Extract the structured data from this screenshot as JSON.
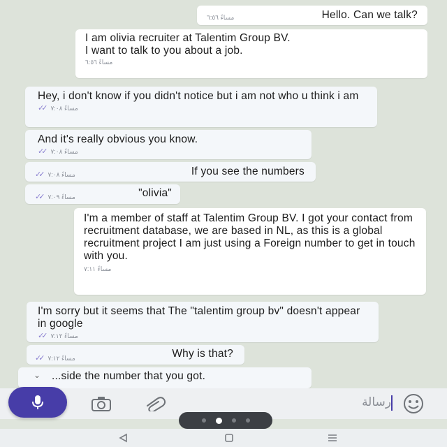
{
  "conversation": {
    "messages": [
      {
        "direction": "out",
        "text": "Hello. Can we talk?",
        "time": "مساءً ٦:٥٦"
      },
      {
        "direction": "out",
        "text": "I am olivia recruiter at Talentim Group BV.\nI want to talk to you about a job.",
        "time": "مساءً ٦:٥٦"
      },
      {
        "direction": "in",
        "text": "Hey, i don't know if you didn't notice but i am not who u think i am",
        "time": "مساءً ٧:٠٨"
      },
      {
        "direction": "in",
        "text": "And it's really obvious you know.",
        "time": "مساءً ٧:٠٨"
      },
      {
        "direction": "in",
        "text": "If you see the numbers",
        "time": "مساءً ٧:٠٨"
      },
      {
        "direction": "in",
        "text": "\"olivia\"",
        "time": "مساءً ٧:٠٩"
      },
      {
        "direction": "out",
        "text": "I'm a member of staff at Talentim Group BV. I got your contact from recruitment database, we are based in NL, as this is a global recruitment project I am just using a Foreign number to get in touch with you.",
        "time": "مساءً ٧:١١"
      },
      {
        "direction": "in",
        "text": "I'm sorry but it seems that The \"talentim group bv\" doesn't appear in google",
        "time": "مساءً ٧:١٢"
      },
      {
        "direction": "in",
        "text": "Why is that?",
        "time": "مساءً ٧:١٢"
      },
      {
        "direction": "in",
        "text": "...side the number that you got.",
        "time": ""
      }
    ]
  },
  "input": {
    "placeholder": "رسالة",
    "mic_icon": "microphone-icon",
    "camera_icon": "camera-icon",
    "attach_icon": "paperclip-icon",
    "emoji_icon": "emoji-icon"
  },
  "colors": {
    "accent": "#473da8",
    "chat_background": "#dde3da",
    "outgoing_bubble": "#ffffff",
    "incoming_bubble": "#f4f7fa",
    "read_ticks": "#8a7fd0"
  }
}
